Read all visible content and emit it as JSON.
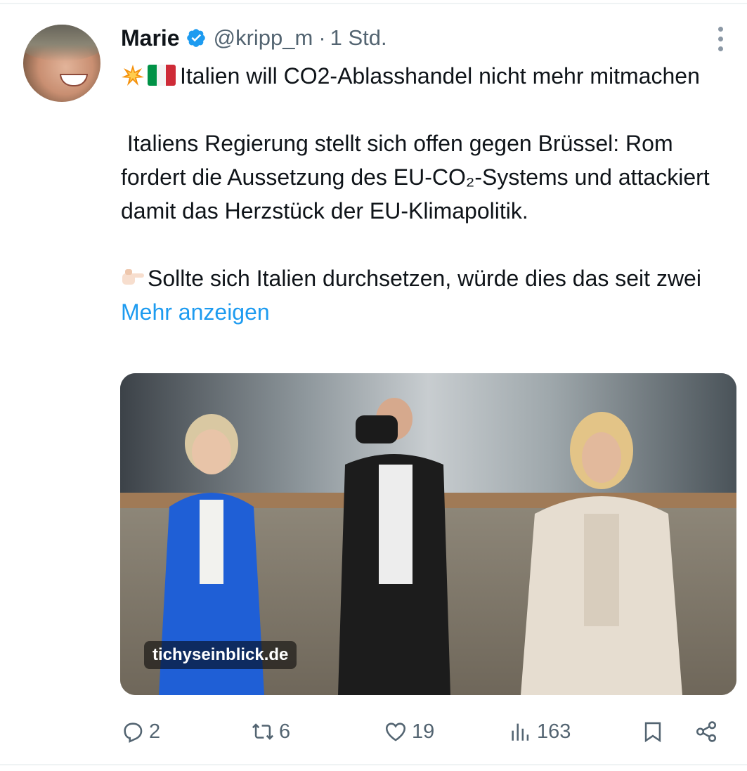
{
  "tweet": {
    "author": {
      "name": "Marie",
      "handle": "@kripp_m",
      "separator": "·",
      "time": "1 Std."
    },
    "text": {
      "line1": "Italien will CO2-Ablasshandel nicht mehr mitmachen",
      "para2": " Italiens Regierung stellt sich offen gegen Brüssel: Rom fordert die Aussetzung des EU-CO₂-Systems und attackiert damit das Herzstück der EU-Klimapolitik.",
      "para3": "Sollte sich Italien durchsetzen, würde dies das seit zwei",
      "more_link": "Mehr anzeigen"
    },
    "media": {
      "watermark": "tichyseinblick.de"
    },
    "actions": {
      "replies": "2",
      "reposts": "6",
      "likes": "19",
      "views": "163"
    },
    "icons": {
      "verified": "verified-badge-icon",
      "more": "more-options-icon",
      "reply": "reply-icon",
      "repost": "repost-icon",
      "like": "heart-icon",
      "views": "views-chart-icon",
      "bookmark": "bookmark-icon",
      "share": "share-icon"
    },
    "colors": {
      "link": "#1d9bf0",
      "secondary_text": "#536471",
      "verified": "#1d9bf0"
    }
  }
}
